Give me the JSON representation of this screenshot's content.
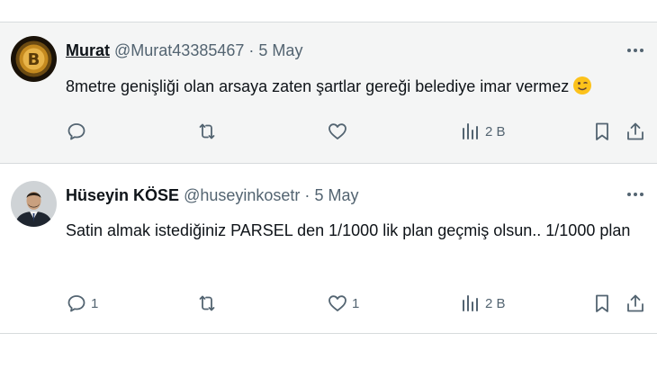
{
  "tweets": [
    {
      "name": "Murat",
      "handle": "@Murat43385467",
      "separator": "·",
      "date": "5 May",
      "text": "8metre genişliği olan arsaya zaten şartlar gereği belediye imar vermez",
      "emoji": "winking-face",
      "avatar": "bitcoin-coin-avatar",
      "replies": "",
      "retweets": "",
      "likes": "",
      "views": "2 B"
    },
    {
      "name": "Hüseyin KÖSE",
      "handle": "@huseyinkosetr",
      "separator": "·",
      "date": "5 May",
      "text": "Satin almak istediğiniz PARSEL den 1/1000 lik plan geçmiş olsun.. 1/1000 plan",
      "avatar": "man-in-suit-avatar",
      "replies": "1",
      "retweets": "",
      "likes": "1",
      "views": "2 B"
    }
  ],
  "colors": {
    "text": "#0f1419",
    "muted": "#536471",
    "highlight_bg": "#f4f5f5",
    "divider": "#d7dbdd"
  }
}
